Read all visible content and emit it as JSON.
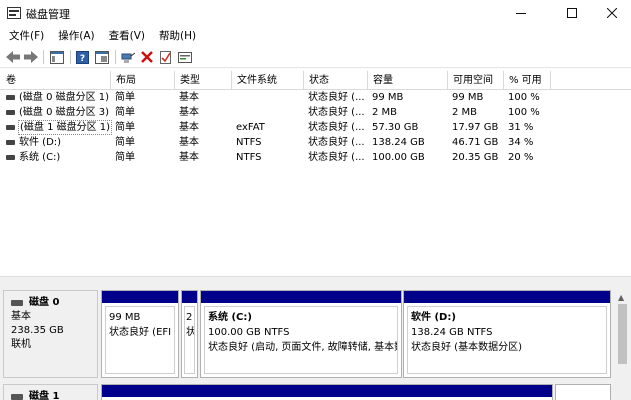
{
  "window": {
    "title": "磁盘管理",
    "min_icon": "minimize-icon",
    "max_icon": "maximize-icon",
    "close_icon": "close-icon"
  },
  "menu": [
    "文件(F)",
    "操作(A)",
    "查看(V)",
    "帮助(H)"
  ],
  "toolbar": [
    "back-icon",
    "forward-icon",
    "console-tree-icon",
    "help-icon",
    "properties-icon",
    "connect-icon",
    "delete-icon",
    "check-icon",
    "settings-icon"
  ],
  "table": {
    "columns": [
      "卷",
      "布局",
      "类型",
      "文件系统",
      "状态",
      "容量",
      "可用空间",
      "% 可用"
    ],
    "rows": [
      [
        "(磁盘 0 磁盘分区 1)",
        "简单",
        "基本",
        "",
        "状态良好 (...",
        "99 MB",
        "99 MB",
        "100 %"
      ],
      [
        "(磁盘 0 磁盘分区 3)",
        "简单",
        "基本",
        "",
        "状态良好 (...",
        "2 MB",
        "2 MB",
        "100 %"
      ],
      [
        "(磁盘 1 磁盘分区 1)",
        "简单",
        "基本",
        "exFAT",
        "状态良好 (...",
        "57.30 GB",
        "17.97 GB",
        "31 %"
      ],
      [
        "软件 (D:)",
        "简单",
        "基本",
        "NTFS",
        "状态良好 (...",
        "138.24 GB",
        "46.71 GB",
        "34 %"
      ],
      [
        "系统 (C:)",
        "简单",
        "基本",
        "NTFS",
        "状态良好 (...",
        "100.00 GB",
        "20.35 GB",
        "20 %"
      ]
    ]
  },
  "disks": [
    {
      "name": "磁盘 0",
      "type": "基本",
      "size": "238.35 GB",
      "status": "联机",
      "partitions": [
        {
          "title": "",
          "line1": "99 MB",
          "line2": "状态良好 (EFI 系"
        },
        {
          "title": "",
          "line1": "2",
          "line2": "状"
        },
        {
          "title": "系统  (C:)",
          "line1": "100.00 GB NTFS",
          "line2": "状态良好 (启动, 页面文件, 故障转储, 基本数"
        },
        {
          "title": "软件  (D:)",
          "line1": "138.24 GB NTFS",
          "line2": "状态良好 (基本数据分区)"
        }
      ]
    },
    {
      "name": "磁盘 1"
    }
  ],
  "colors": {
    "partition_bar": "#00008b",
    "delete": "#cc1111"
  }
}
